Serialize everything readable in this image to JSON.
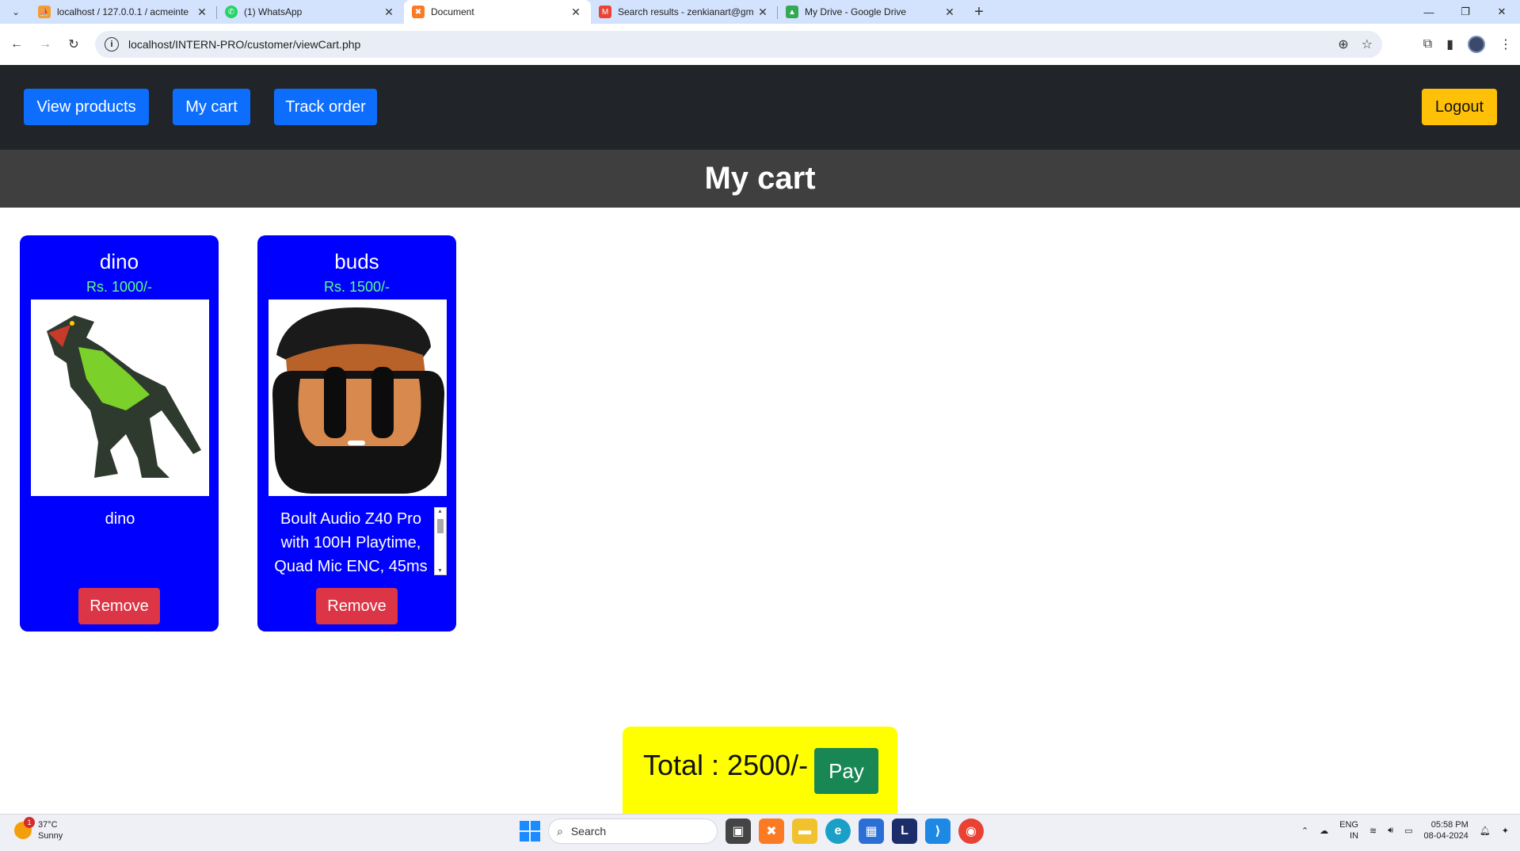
{
  "browser": {
    "tabs": [
      {
        "title": "localhost / 127.0.0.1 / acmeinte",
        "icon": "phpmyadmin-icon",
        "color": "#f0a030",
        "active": false
      },
      {
        "title": "(1) WhatsApp",
        "icon": "whatsapp-icon",
        "color": "#25d366",
        "active": false
      },
      {
        "title": "Document",
        "icon": "xampp-icon",
        "color": "#fb7a24",
        "active": true
      },
      {
        "title": "Search results - zenkianart@gm",
        "icon": "gmail-icon",
        "color": "#ea4335",
        "active": false
      },
      {
        "title": "My Drive - Google Drive",
        "icon": "google-drive-icon",
        "color": "#34a853",
        "active": false
      }
    ],
    "url": "localhost/INTERN-PRO/customer/viewCart.php"
  },
  "nav": {
    "view_products": "View products",
    "my_cart": "My cart",
    "track_order": "Track order",
    "logout": "Logout"
  },
  "page": {
    "title": "My cart"
  },
  "cart": {
    "items": [
      {
        "name": "dino",
        "price": "Rs. 1000/-",
        "description": "dino",
        "remove": "Remove"
      },
      {
        "name": "buds",
        "price": "Rs. 1500/-",
        "description": "Boult Audio Z40 Pro with 100H Playtime, Quad Mic ENC, 45ms",
        "remove": "Remove"
      }
    ],
    "total": "Total : 2500/-",
    "pay": "Pay"
  },
  "taskbar": {
    "temperature": "37°C",
    "condition": "Sunny",
    "weather_badge": "1",
    "search_placeholder": "Search",
    "lang": "ENG",
    "region": "IN",
    "time": "05:58 PM",
    "date": "08-04-2024"
  }
}
